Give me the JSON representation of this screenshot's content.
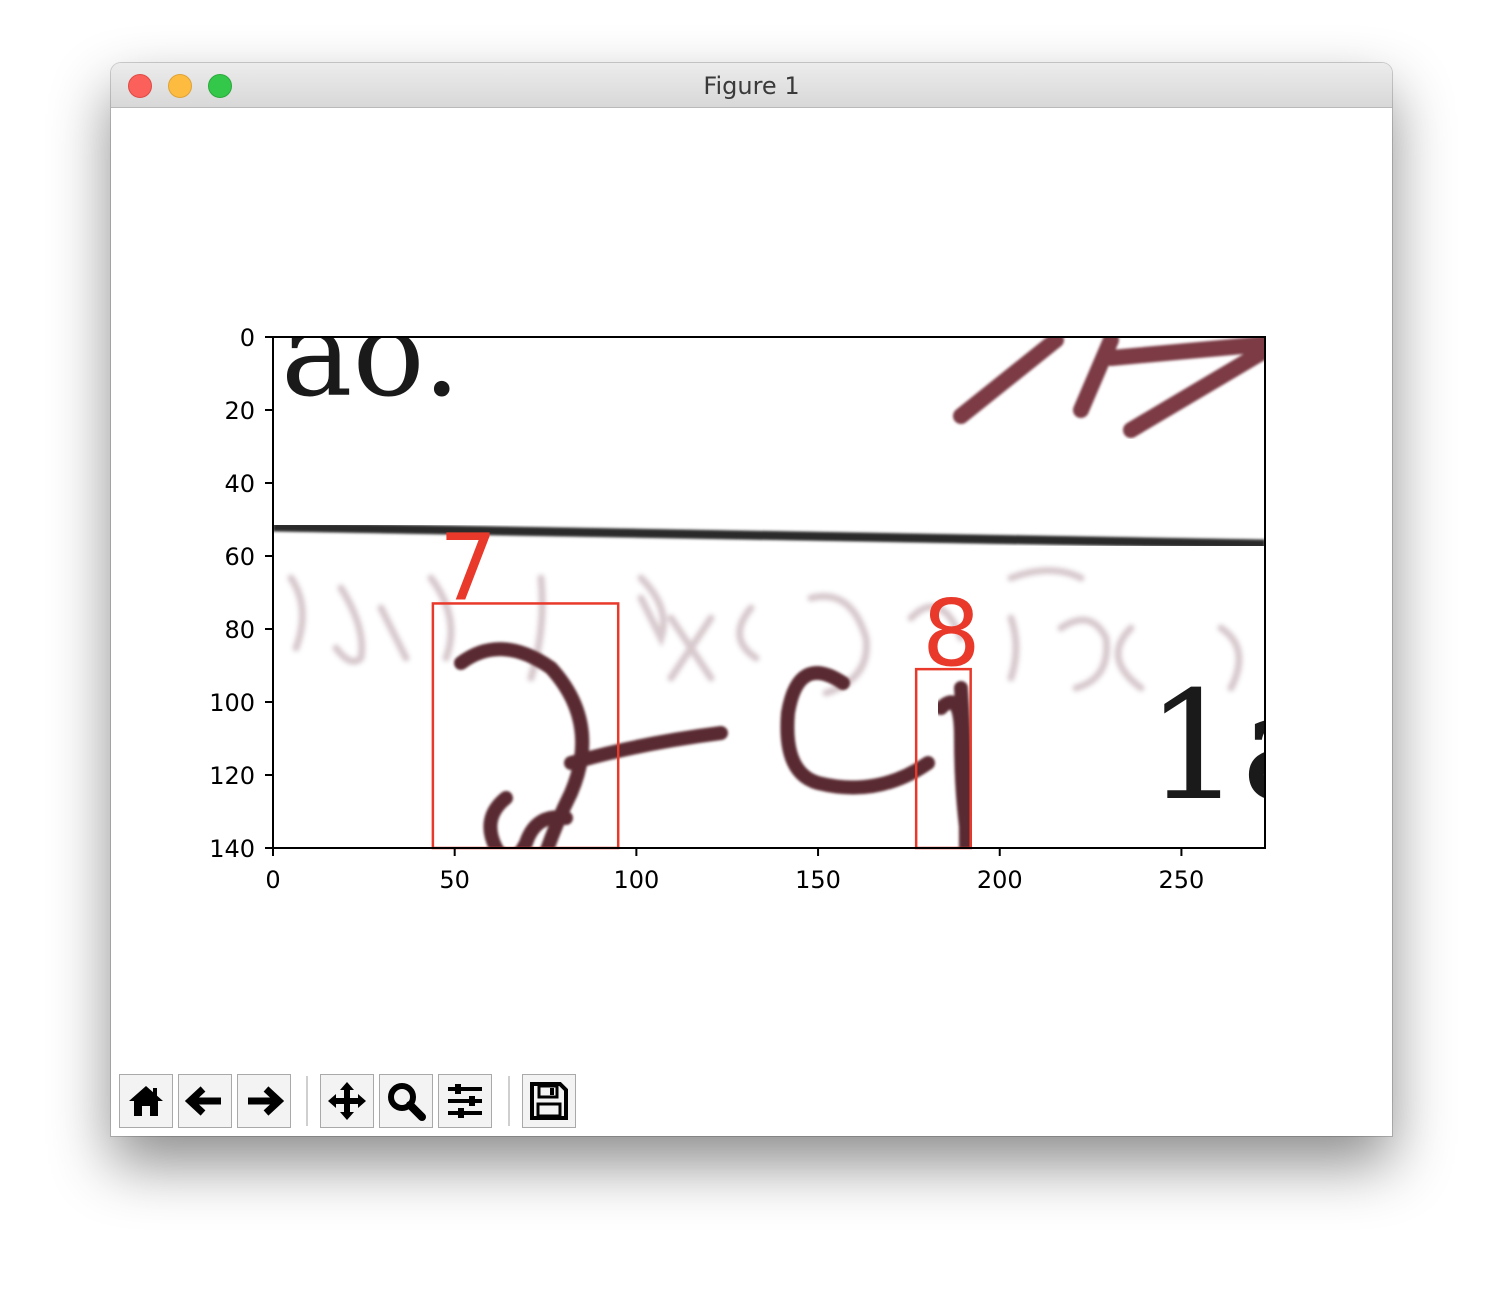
{
  "window": {
    "title": "Figure 1"
  },
  "axes": {
    "x_ticks": [
      "0",
      "50",
      "100",
      "150",
      "200",
      "250"
    ],
    "x_tick_values": [
      0,
      50,
      100,
      150,
      200,
      250
    ],
    "y_ticks": [
      "0",
      "20",
      "40",
      "60",
      "80",
      "100",
      "120",
      "140"
    ],
    "y_tick_values": [
      0,
      20,
      40,
      60,
      80,
      100,
      120,
      140
    ],
    "x_range": [
      0,
      273
    ],
    "y_range": [
      0,
      140
    ],
    "y_inverted": true
  },
  "annotations": [
    {
      "label": "7",
      "box": {
        "x0": 44,
        "y0": 73,
        "x1": 95,
        "y1": 140
      },
      "color": "#e8392b"
    },
    {
      "label": "8",
      "box": {
        "x0": 177,
        "y0": 91,
        "x1": 192,
        "y1": 140
      },
      "color": "#e8392b"
    }
  ],
  "image_text": {
    "top_left": "ao.",
    "bottom_right": "1a"
  },
  "toolbar": {
    "buttons": [
      {
        "name": "home-button",
        "icon": "home-icon"
      },
      {
        "name": "back-button",
        "icon": "arrow-left-icon"
      },
      {
        "name": "forward-button",
        "icon": "arrow-right-icon"
      },
      {
        "name": "pan-button",
        "icon": "move-icon"
      },
      {
        "name": "zoom-button",
        "icon": "magnifier-icon"
      },
      {
        "name": "configure-subplots-button",
        "icon": "sliders-icon"
      },
      {
        "name": "save-button",
        "icon": "floppy-disk-icon"
      }
    ]
  }
}
